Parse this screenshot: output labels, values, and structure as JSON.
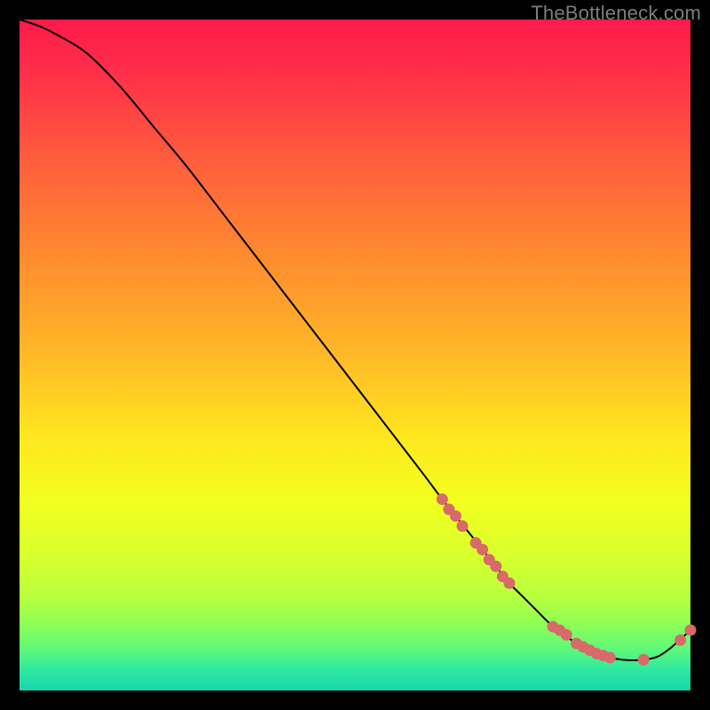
{
  "watermark": "TheBottleneck.com",
  "chart_data": {
    "type": "line",
    "title": "",
    "xlabel": "",
    "ylabel": "",
    "xlim": [
      0,
      100
    ],
    "ylim": [
      0,
      100
    ],
    "series": [
      {
        "name": "curve",
        "x": [
          0,
          3,
          6,
          10,
          15,
          20,
          25,
          30,
          35,
          40,
          45,
          50,
          55,
          60,
          63,
          65,
          67,
          69,
          71,
          73,
          75,
          77,
          79,
          81,
          83,
          85,
          87,
          89,
          91,
          93,
          95,
          97,
          100
        ],
        "y": [
          100,
          99,
          97.5,
          95,
          90,
          84,
          78,
          71.5,
          65,
          58.5,
          52,
          45.5,
          39,
          32.5,
          28.5,
          26,
          23.5,
          21,
          18.5,
          16,
          14,
          12,
          10,
          8.5,
          7,
          6,
          5.2,
          4.7,
          4.5,
          4.6,
          5.0,
          6.3,
          9
        ]
      }
    ],
    "markers": [
      {
        "x": 63,
        "y": 28.5
      },
      {
        "x": 64,
        "y": 27.0
      },
      {
        "x": 65,
        "y": 26.0
      },
      {
        "x": 66,
        "y": 24.5
      },
      {
        "x": 68,
        "y": 22.0
      },
      {
        "x": 69,
        "y": 21.0
      },
      {
        "x": 70,
        "y": 19.5
      },
      {
        "x": 71,
        "y": 18.5
      },
      {
        "x": 72,
        "y": 17.0
      },
      {
        "x": 73,
        "y": 16.0
      },
      {
        "x": 79.5,
        "y": 9.5
      },
      {
        "x": 80.5,
        "y": 9.0
      },
      {
        "x": 81.5,
        "y": 8.3
      },
      {
        "x": 83,
        "y": 7.0
      },
      {
        "x": 84,
        "y": 6.5
      },
      {
        "x": 85,
        "y": 6.0
      },
      {
        "x": 86,
        "y": 5.5
      },
      {
        "x": 87,
        "y": 5.2
      },
      {
        "x": 88,
        "y": 4.9
      },
      {
        "x": 93,
        "y": 4.6
      },
      {
        "x": 98.5,
        "y": 7.5
      },
      {
        "x": 100,
        "y": 9.0
      }
    ],
    "gradient_stops": [
      {
        "pos": 0.0,
        "color": "#ff1a4b"
      },
      {
        "pos": 0.08,
        "color": "#ff2f49"
      },
      {
        "pos": 0.2,
        "color": "#ff5a3e"
      },
      {
        "pos": 0.35,
        "color": "#ff8a2f"
      },
      {
        "pos": 0.5,
        "color": "#ffb927"
      },
      {
        "pos": 0.62,
        "color": "#ffe61f"
      },
      {
        "pos": 0.72,
        "color": "#f2ff1f"
      },
      {
        "pos": 0.8,
        "color": "#d8ff2d"
      },
      {
        "pos": 0.86,
        "color": "#b8ff3c"
      },
      {
        "pos": 0.9,
        "color": "#8fff55"
      },
      {
        "pos": 0.94,
        "color": "#5cf87a"
      },
      {
        "pos": 0.97,
        "color": "#2de8a1"
      },
      {
        "pos": 1.0,
        "color": "#19d6b0"
      }
    ],
    "marker_color": "#d86a6a",
    "line_color": "#000000"
  }
}
